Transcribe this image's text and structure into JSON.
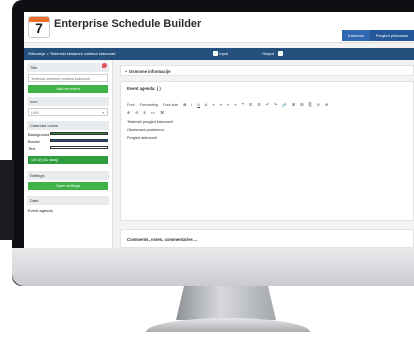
{
  "app": {
    "logo_number": "7",
    "title": "Enterprise Schedule Builder",
    "nav": [
      "Kalendar",
      "Pregled prikazano"
    ]
  },
  "pathbar": {
    "path": "Stilovanje  >  Tedenski sestanek vodstva kakovosti",
    "input_label": "Input",
    "output_label": "Output"
  },
  "sidebar": {
    "title_header": "Title",
    "title_value": "Tedenski sestanek vodstva kakovosti",
    "add_event": "Add an event",
    "icon_header": "Icon",
    "icon_value": "LIAH",
    "colors_header": "Calendar colors",
    "bg_label": "Background",
    "border_label": "Border",
    "text_label": "Text",
    "status_chip": "100 (2) (Za nazaj)",
    "settings_header": "Settings",
    "open_settings": "Open settings",
    "date_header": "Date",
    "event_agenda": "Event agenda"
  },
  "main": {
    "section_header": "Osnovne informacije",
    "agenda_title": "Event agenda: ( )",
    "toolbar": [
      "Font",
      "Formatting",
      "Font size",
      "B",
      "I",
      "U",
      "A",
      "≡",
      "≡",
      "≡",
      "≡",
      "❞",
      "☰",
      "☰",
      "↶",
      "↷",
      "🔗",
      "⊞",
      "⊞",
      "⎘",
      "⊝",
      "⊕"
    ],
    "toolbar2": [
      "⊕",
      "⊖",
      "$",
      "<>",
      "⌘"
    ],
    "lines": [
      "Tedenski pregled kakovosti",
      "Obravnava problemov",
      "Pregled aktivnosti"
    ],
    "comments_header": "Comments, notes, commentaries ..."
  }
}
